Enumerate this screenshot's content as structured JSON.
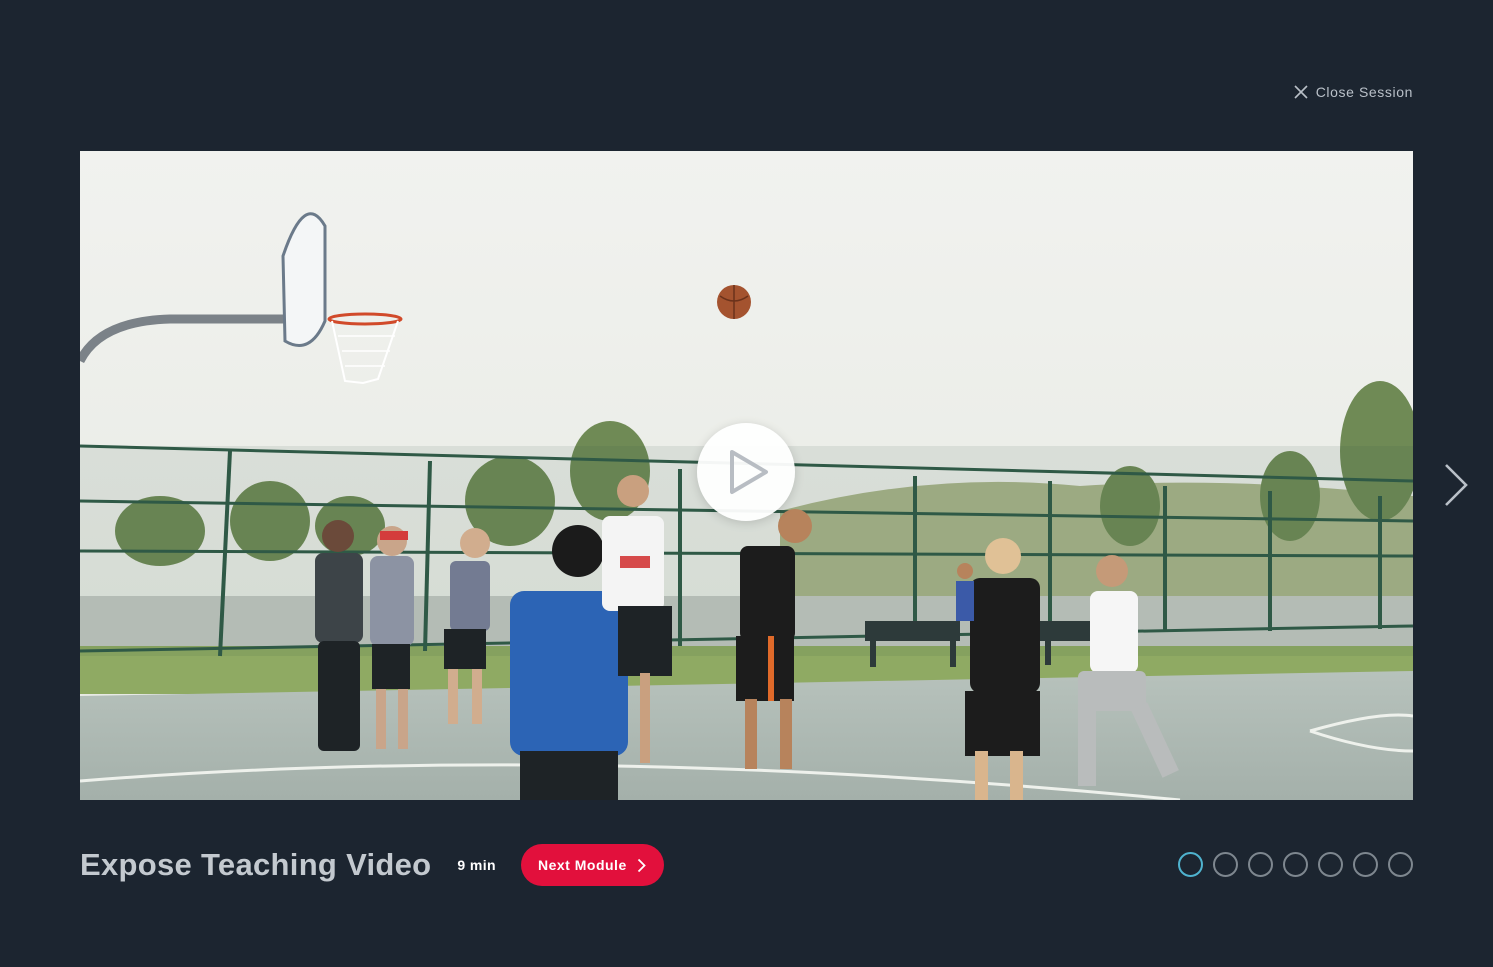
{
  "header": {
    "close_label": "Close Session",
    "close_icon": "close-icon"
  },
  "video": {
    "play_icon": "play-icon",
    "next_icon": "chevron-right-icon"
  },
  "footer": {
    "title": "Expose Teaching Video",
    "duration": "9 min",
    "next_module_label": "Next Module"
  },
  "pager": {
    "total": 7,
    "active_index": 0,
    "active_color": "#4fb3cf",
    "inactive_color": "#7e878f"
  },
  "colors": {
    "background": "#1c2530",
    "accent": "#e2103c"
  }
}
